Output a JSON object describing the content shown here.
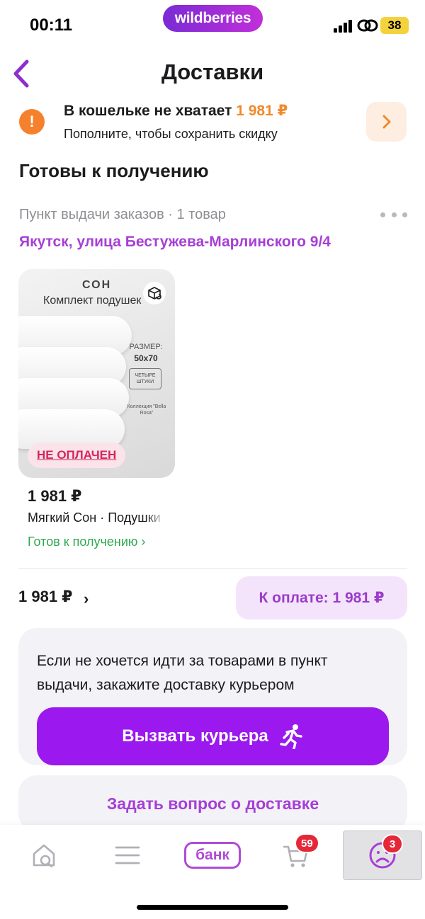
{
  "status_bar": {
    "time": "00:11",
    "brand": "wildberries",
    "battery": "38"
  },
  "header": {
    "title": "Доставки",
    "back_icon": "chevron-left-icon"
  },
  "wallet_banner": {
    "title": "В кошельке не хватает",
    "amount": "1 981 ₽",
    "subtitle": "Пополните, чтобы сохранить скидку",
    "icon": "exclamation-icon"
  },
  "section": {
    "title": "Готовы к получению",
    "pickup_type": "Пункт выдачи заказов · 1 товар",
    "address": "Якутск, улица Бестужева-Марлинского 9/4"
  },
  "product": {
    "image": {
      "brand_mark": "СОН",
      "set_title": "Комплект подушек",
      "size_label": "РАЗМЕР:",
      "size_value": "50х70",
      "qty": "ЧЕТЫРЕ ШТУКИ",
      "collection": "Коллекция \"Bella Rosa\""
    },
    "badge": "НЕ ОПЛАЧЕН",
    "price": "1 981 ₽",
    "name": "Мягкий Сон · Подушки",
    "status": "Готов к получению ›"
  },
  "summary": {
    "total": "1 981 ₽",
    "chevron": "›",
    "pay_label": "К оплате: 1 981 ₽"
  },
  "courier": {
    "text": "Если не хочется идти за товарами в пункт выдачи, закажите доставку курьером",
    "button": "Вызвать курьера"
  },
  "question": {
    "label": "Задать вопрос о доставке"
  },
  "tab_bar": {
    "bank_label": "банк",
    "cart_badge": "59",
    "profile_badge": "3"
  },
  "colors": {
    "accent": "#9b19ee",
    "link_purple": "#a63fd6",
    "warning": "#f5812d",
    "success": "#2fa84f",
    "danger": "#e52838"
  }
}
